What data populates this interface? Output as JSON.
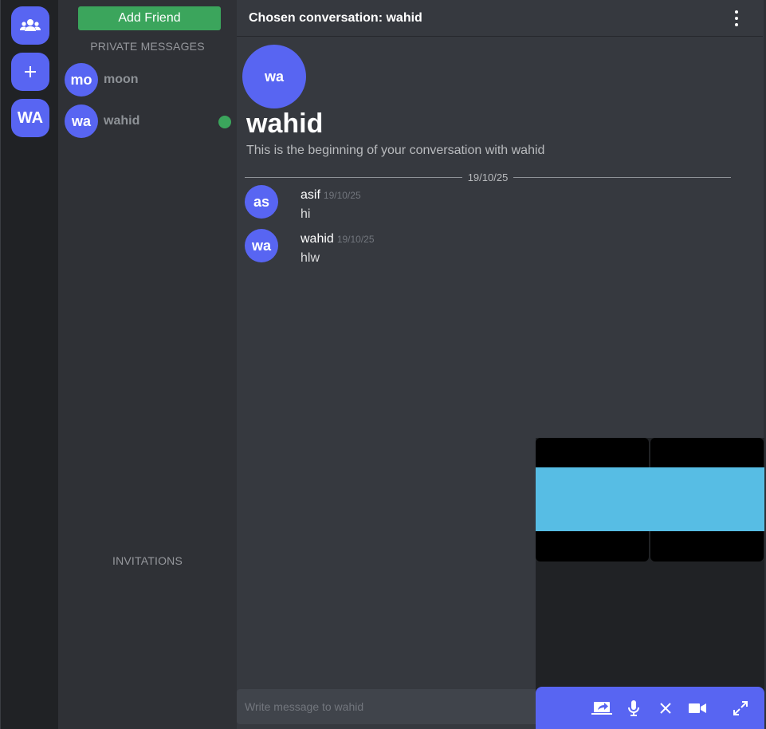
{
  "rail": {
    "friends_icon": "friends-icon",
    "add_icon": "plus-icon",
    "user_initials": "WA"
  },
  "sidebar": {
    "add_friend_label": "Add Friend",
    "private_messages_label": "PRIVATE MESSAGES",
    "invitations_label": "INVITATIONS",
    "dms": [
      {
        "initials": "mo",
        "name": "moon",
        "online": false
      },
      {
        "initials": "wa",
        "name": "wahid",
        "online": true
      }
    ]
  },
  "chat": {
    "title": "Chosen conversation: wahid",
    "intro_initials": "wa",
    "intro_name": "wahid",
    "intro_subtitle": "This is the beginning of your conversation with wahid",
    "date_divider": "19/10/25",
    "messages": [
      {
        "initials": "as",
        "author": "asif",
        "time": "19/10/25",
        "text": "hi"
      },
      {
        "initials": "wa",
        "author": "wahid",
        "time": "19/10/25",
        "text": "hlw"
      }
    ],
    "composer_placeholder": "Write message to wahid"
  },
  "call": {
    "controls": [
      "screen-share-icon",
      "microphone-icon",
      "close-icon",
      "video-camera-icon",
      "expand-icon"
    ]
  },
  "colors": {
    "accent": "#5865f2",
    "online": "#3ba55c",
    "add_friend": "#3ba55c",
    "video_stream": "#57bde4"
  }
}
